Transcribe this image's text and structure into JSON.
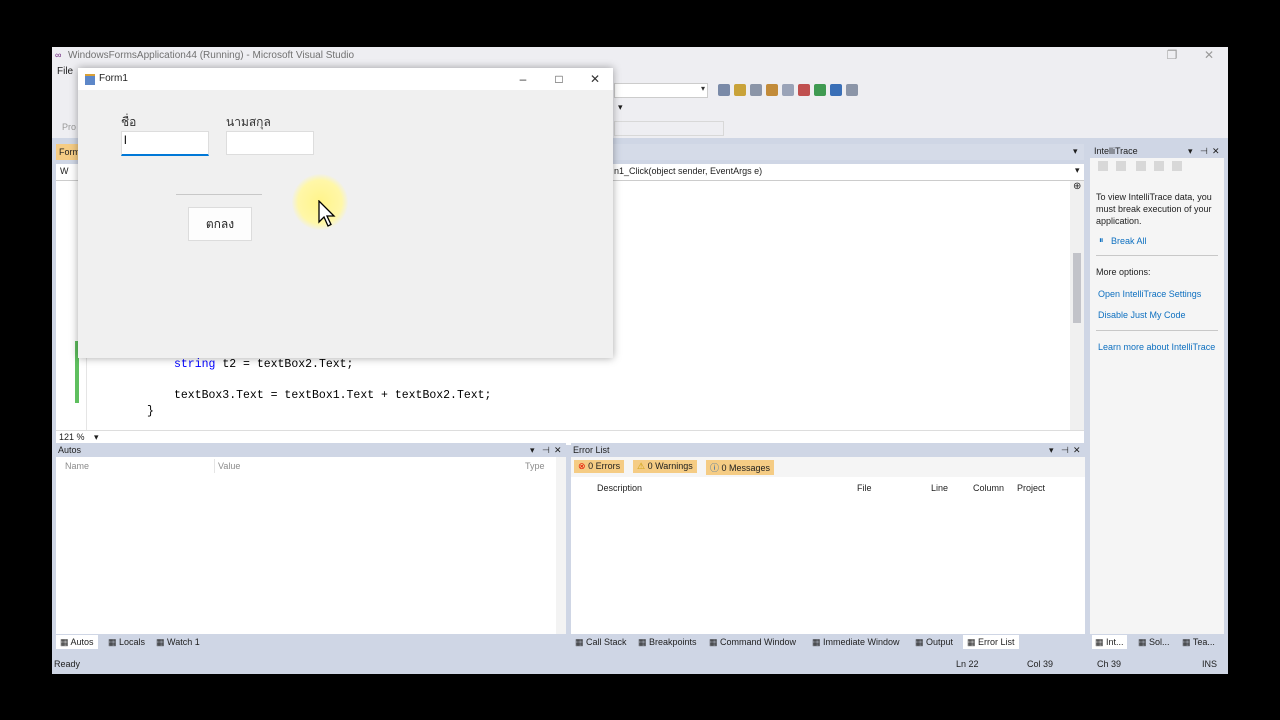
{
  "vs": {
    "window_title": "WindowsFormsApplication44 (Running) - Microsoft Visual Studio",
    "menu_file": "File",
    "toolbar_hint": "Pro",
    "editor_tab": "Form",
    "nav_left": "W",
    "nav_method": "n1_Click(object sender, EventArgs e)",
    "zoom": "121 %",
    "code": {
      "line1_kw": "string",
      "line1_rest": " t2 = textBox2.Text;",
      "line2": "textBox3.Text = textBox1.Text + textBox2.Text;",
      "line3": "}"
    }
  },
  "form1": {
    "title": "Form1",
    "label_first": "ชื่อ",
    "label_last": "นามสกุล",
    "first_value": "l",
    "ok_button": "ตกลง"
  },
  "intellitrace": {
    "title": "IntelliTrace",
    "info": "To view IntelliTrace data, you must break execution of your application.",
    "break_all": "Break All",
    "more_options": "More options:",
    "open_settings": "Open IntelliTrace Settings",
    "disable_jmc": "Disable Just My Code",
    "learn_more": "Learn more about IntelliTrace"
  },
  "autos": {
    "title": "Autos",
    "col_name": "Name",
    "col_value": "Value",
    "col_type": "Type",
    "tabs": [
      "Autos",
      "Locals",
      "Watch 1"
    ]
  },
  "errorlist": {
    "title": "Error List",
    "errors": "0 Errors",
    "warnings": "0 Warnings",
    "messages": "0 Messages",
    "col_description": "Description",
    "col_file": "File",
    "col_line": "Line",
    "col_column": "Column",
    "col_project": "Project",
    "tabs": [
      "Call Stack",
      "Breakpoints",
      "Command Window",
      "Immediate Window",
      "Output",
      "Error List"
    ]
  },
  "right_tabs": [
    "Int...",
    "Sol...",
    "Tea..."
  ],
  "status": {
    "ready": "Ready",
    "ln": "Ln 22",
    "col": "Col 39",
    "ch": "Ch 39",
    "ins": "INS"
  },
  "colors": {
    "accent": "#0078d7",
    "link": "#0e70c0",
    "keyword": "#0000ff",
    "tab_highlight": "#f5cc84"
  }
}
